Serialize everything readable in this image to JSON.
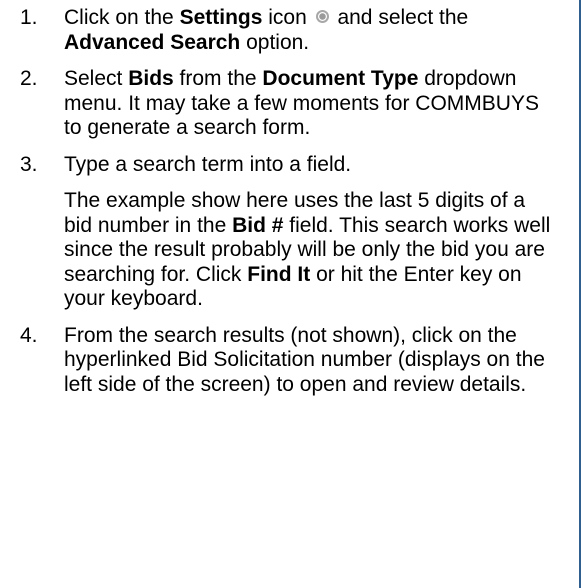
{
  "steps": [
    {
      "number": "1.",
      "segments": [
        {
          "text": "Click on the ",
          "bold": false
        },
        {
          "text": "Settings",
          "bold": true
        },
        {
          "text": " icon ",
          "bold": false
        },
        {
          "icon": "gear-icon"
        },
        {
          "text": " and select the ",
          "bold": false
        },
        {
          "text": "Advanced Search",
          "bold": true
        },
        {
          "text": " option.",
          "bold": false
        }
      ]
    },
    {
      "number": "2.",
      "segments": [
        {
          "text": "Select ",
          "bold": false
        },
        {
          "text": "Bids",
          "bold": true
        },
        {
          "text": " from the ",
          "bold": false
        },
        {
          "text": "Document Type",
          "bold": true
        },
        {
          "text": " dropdown menu. It may take a few moments for COMMBUYS to generate a search form.",
          "bold": false
        }
      ]
    },
    {
      "number": "3.",
      "segments": [
        {
          "text": "Type a search term into a field.",
          "bold": false
        }
      ],
      "followup": [
        {
          "text": "The example show here uses the last 5 digits of a bid number in the ",
          "bold": false
        },
        {
          "text": "Bid #",
          "bold": true
        },
        {
          "text": " field. This search works well since the result probably will be only the bid you are searching for. Click ",
          "bold": false
        },
        {
          "text": "Find It",
          "bold": true
        },
        {
          "text": " or hit the Enter key on your keyboard.",
          "bold": false
        }
      ]
    },
    {
      "number": "4.",
      "segments": [
        {
          "text": "From the search results (not shown), click on the hyperlinked Bid Solicitation number (displays on the left side of the screen) to open and review details.",
          "bold": false
        }
      ]
    }
  ],
  "colors": {
    "text": "#000000",
    "background": "#ffffff",
    "right_rule": "#2f5f8f"
  }
}
